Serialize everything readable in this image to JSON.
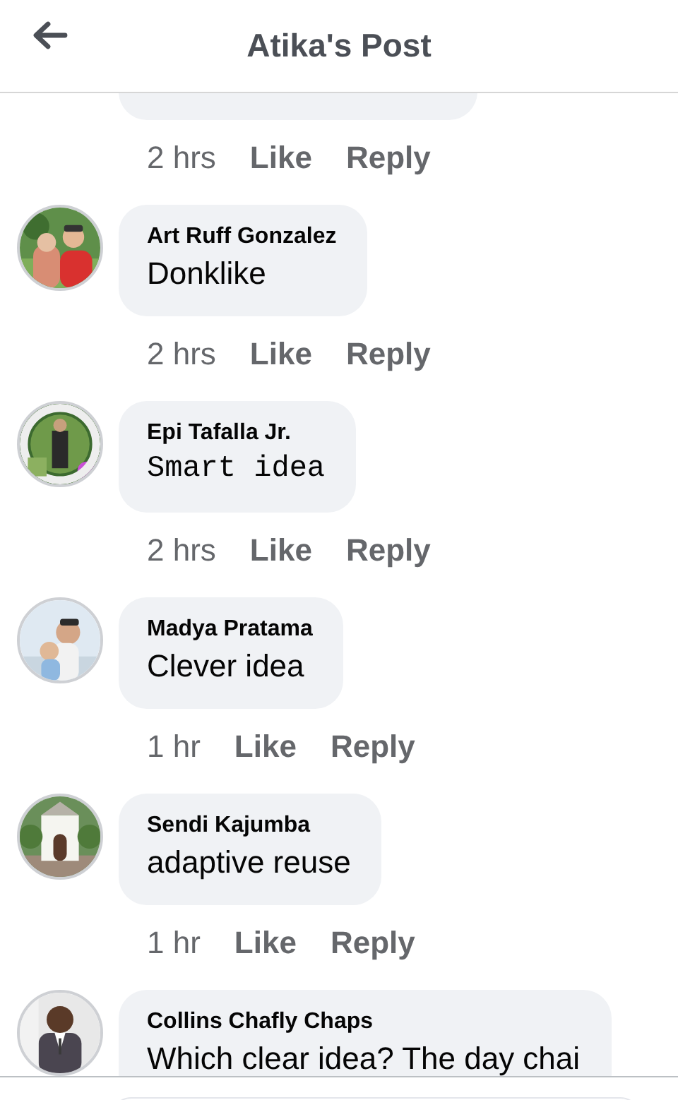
{
  "header": {
    "title": "Atika's Post"
  },
  "comments": [
    {
      "kind": "plain",
      "time": "2 hrs",
      "like": "Like",
      "reply": "Reply"
    },
    {
      "kind": "plain",
      "author": "Art Ruff Gonzalez",
      "text": "Donklike",
      "time": "2 hrs",
      "like": "Like",
      "reply": "Reply"
    },
    {
      "kind": "typewriter",
      "author": "Epi Tafalla Jr.",
      "text": "Smart idea",
      "time": "2 hrs",
      "like": "Like",
      "reply": "Reply"
    },
    {
      "kind": "plain",
      "author": "Madya Pratama",
      "text": "Clever idea",
      "time": "1 hr",
      "like": "Like",
      "reply": "Reply"
    },
    {
      "kind": "plain",
      "author": "Sendi Kajumba",
      "text": "adaptive reuse",
      "time": "1 hr",
      "like": "Like",
      "reply": "Reply"
    },
    {
      "kind": "plain",
      "author": "Collins Chafly Chaps",
      "text": "Which clear idea? The day chai"
    }
  ]
}
